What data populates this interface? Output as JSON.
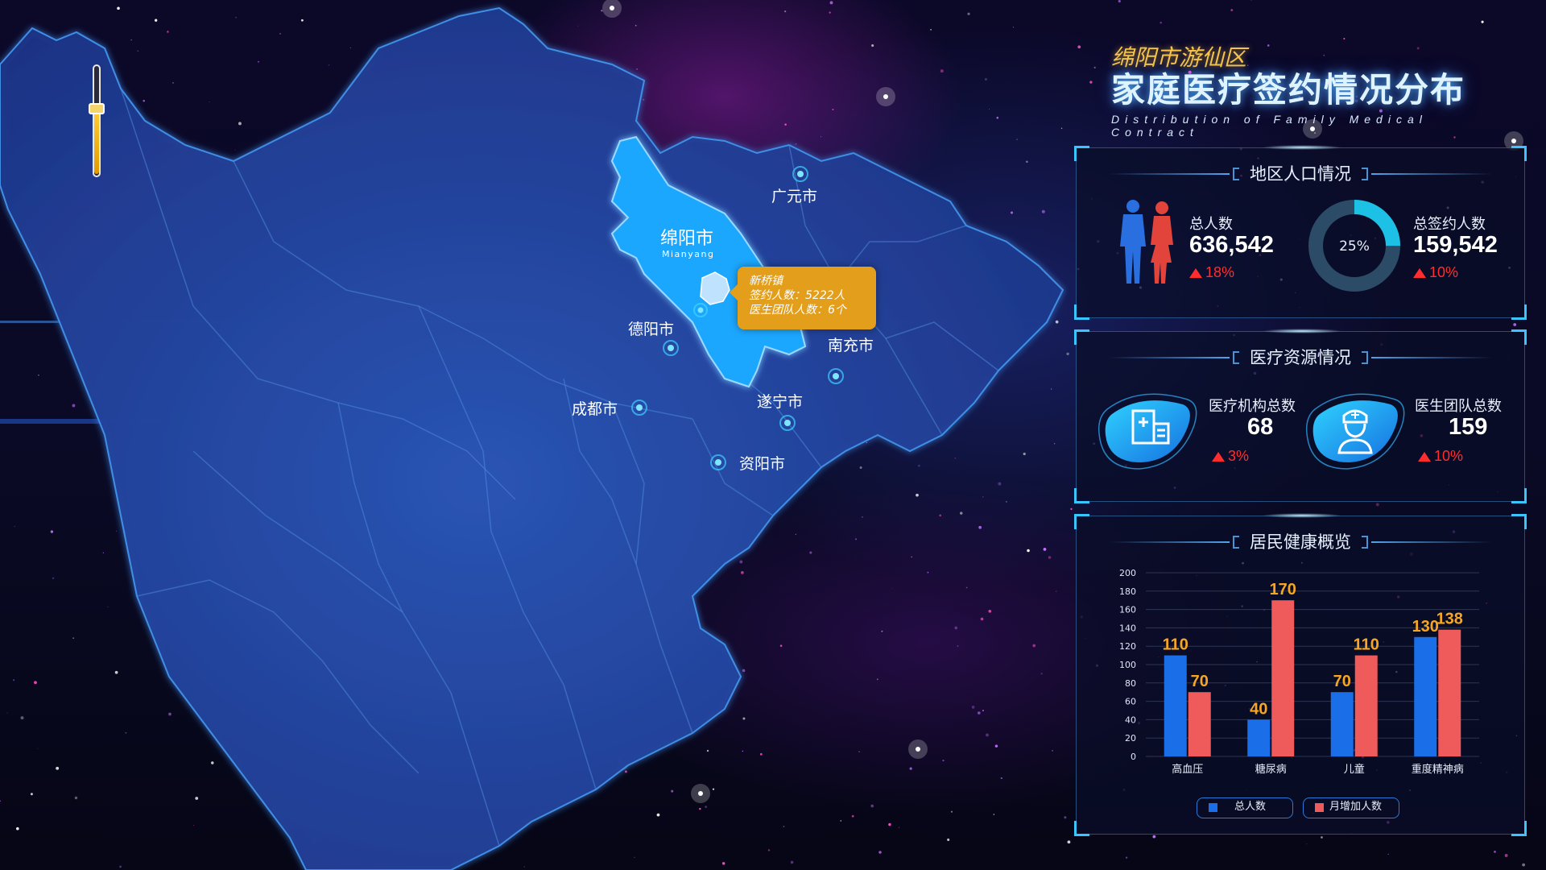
{
  "title": {
    "subtitle": "绵阳市游仙区",
    "main": "家庭医疗签约情况分布",
    "english": "Distribution of Family Medical Contract"
  },
  "map": {
    "zoom_level": 0.62,
    "highlighted_city": {
      "name": "绵阳市",
      "english": "Mianyang"
    },
    "cities": [
      "广元市",
      "德阳市",
      "南充市",
      "成都市",
      "遂宁市",
      "资阳市"
    ],
    "tooltip": {
      "line1": "新桥镇",
      "line2": "签约人数：5222人",
      "line3": "医生团队人数：6个"
    },
    "colors": {
      "region": "#1f3a8c",
      "border": "#3f8ee6",
      "highlight": "#1ea7ff",
      "tooltip": "#e39f1b"
    }
  },
  "population": {
    "title": "地区人口情况",
    "total_label": "总人数",
    "total_value": "636,542",
    "total_trend": "18%",
    "signed_label": "总签约人数",
    "signed_value": "159,542",
    "signed_trend": "10%",
    "donut_label": "25%",
    "donut_fraction": 0.25,
    "icons": [
      "male-figure-icon",
      "female-figure-icon"
    ]
  },
  "medical": {
    "title": "医疗资源情况",
    "inst_label": "医疗机构总数",
    "inst_value": "68",
    "inst_trend": "3%",
    "team_label": "医生团队总数",
    "team_value": "159",
    "team_trend": "10%",
    "icons": [
      "hospital-icon",
      "doctor-icon"
    ]
  },
  "health": {
    "title": "居民健康概览"
  },
  "chart_data": {
    "type": "bar",
    "categories": [
      "高血压",
      "糖尿病",
      "儿童",
      "重度精神病"
    ],
    "series": [
      {
        "name": "总人数",
        "values": [
          110,
          40,
          70,
          130
        ],
        "color": "#1a6fe8"
      },
      {
        "name": "月增加人数",
        "values": [
          70,
          170,
          110,
          138
        ],
        "color": "#ef5a5a"
      }
    ],
    "data_labels": [
      [
        "110",
        "40",
        "70",
        "130"
      ],
      [
        "70",
        "170",
        "110",
        "138"
      ]
    ],
    "ylim": [
      0,
      200
    ],
    "yticks": [
      0,
      20,
      40,
      60,
      80,
      100,
      120,
      140,
      160,
      180,
      200
    ],
    "grid": true,
    "legend_position": "bottom"
  }
}
